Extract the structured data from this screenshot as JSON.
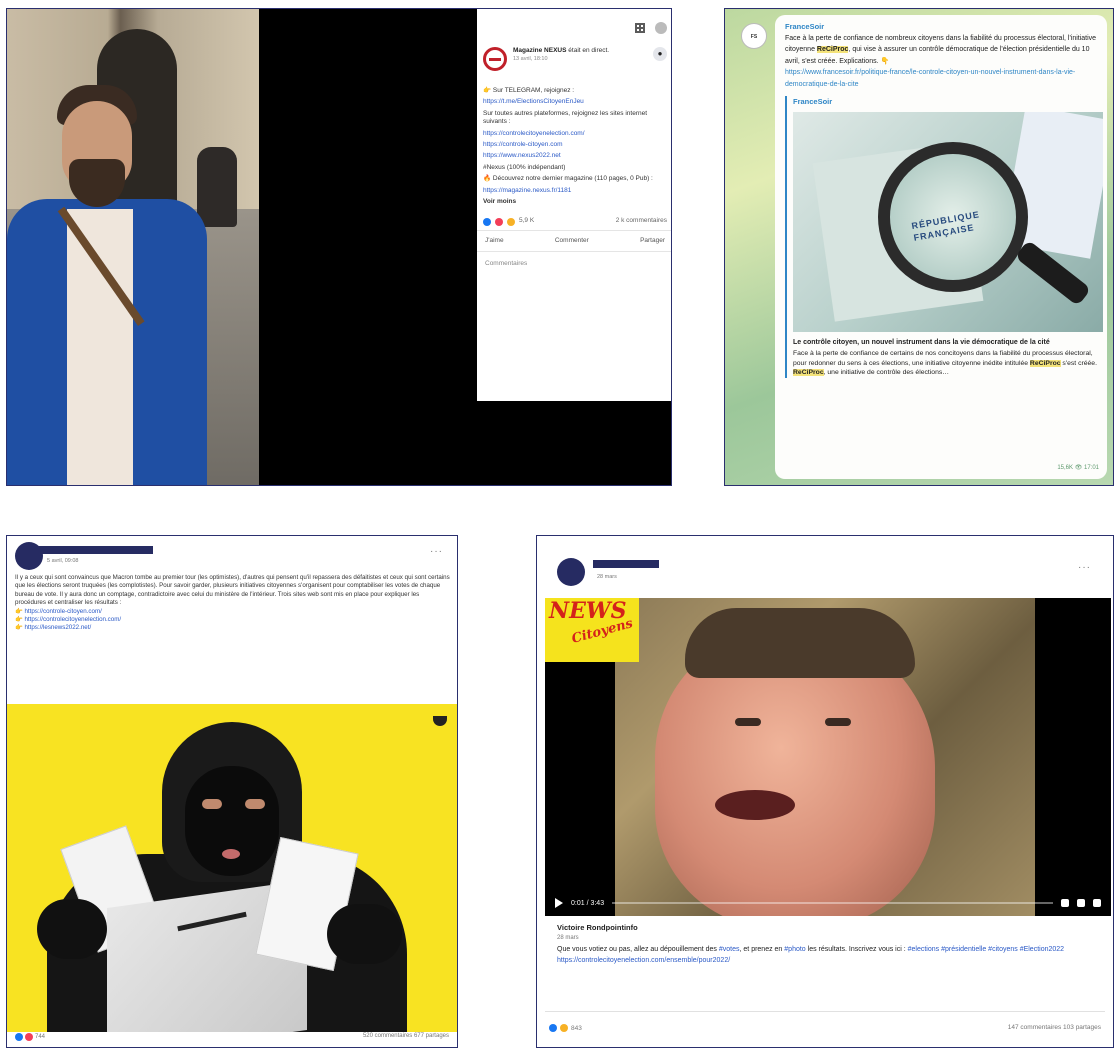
{
  "panel1": {
    "post": {
      "author": "Magazine NEXUS",
      "status": "était en direct.",
      "date": "13 avril, 18:10",
      "line1": "👉 Sur TELEGRAM, rejoignez :",
      "link1": "https://t.me/ElectionsCitoyenEnJeu",
      "line2": "Sur toutes autres plateformes, rejoignez les sites internet suivants :",
      "link2": "https://controlecitoyenelection.com/",
      "link3": "https://controle-citoyen.com",
      "link4": "https://www.nexus2022.net",
      "line3": "#Nexus (100% indépendant)",
      "line4": "🔥 Découvrez notre dernier magazine (110 pages, 0 Pub) :",
      "link5": "https://magazine.nexus.fr/1181",
      "see_more": "Voir moins",
      "reaction_count": "5,9 K",
      "comment_count": "2 k commentaires",
      "action_like": "J'aime",
      "action_comment": "Commenter",
      "action_share": "Partager",
      "comment_placeholder": "Commentaires"
    }
  },
  "panel2": {
    "avatar_label": "FS",
    "channel": "FranceSoir",
    "text_part1": "Face à la perte de confiance de nombreux citoyens dans la fiabilité du processus électoral, l'initiative citoyenne ",
    "highlight": "ReCiProc",
    "text_part2": ", qui vise à assurer un contrôle démocratique de l'élection présidentielle du 10 avril, s'est créée. Explications. 👇",
    "link": "https://www.francesoir.fr/politique-france/le-controle-citoyen-un-nouvel-instrument-dans-la-vie-democratique-de-la-cite",
    "preview_source": "FranceSoir",
    "preview_image_text": "RÉPUBLIQUE FRANÇAISE",
    "preview_title": "Le contrôle citoyen, un nouvel instrument dans la vie démocratique de la cité",
    "preview_desc_part1": "Face à la perte de confiance de certains de nos concitoyens dans la fiabilité du processus électoral, pour redonner du sens à ces élections, une initiative citoyenne inédite intitulée ",
    "preview_desc_part2": " s'est créée. ",
    "preview_desc_part3": ", une initiative de contrôle des élections…",
    "views": "15,6K",
    "time": "17:01"
  },
  "panel3": {
    "date": "5 avril, 09:08",
    "text": "Il y a ceux qui sont convaincus que Macron tombe au premier tour (les optimistes), d'autres qui pensent qu'il repassera des défaitistes et ceux qui sont certains que les élections seront truquées (les complotistes). Pour savoir garder, plusieurs initiatives citoyennes s'organisent pour comptabiliser les votes de chaque bureau de vote. Il y aura donc un comptage, contradictoire avec celui du ministère de l'intérieur. Trois sites web sont mis en place pour expliquer les procédures et centraliser les résultats :",
    "link1": "https://controle-citoyen.com/",
    "link2": "https://controlecitoyenelection.com/",
    "link3": "https://lesnews2022.net/",
    "reaction_count": "744",
    "stats": "520 commentaires 677 partages"
  },
  "panel4": {
    "date": "28 mars",
    "news_word": "NEWS",
    "citoyens_word": "Citoyens",
    "video_time": "0:01 / 3:43",
    "author": "Victoire Rondpointinfo",
    "author_date": "28 mars",
    "text_part1": "Que vous votiez ou pas, allez au dépouillement des ",
    "tag1": "#votes",
    "text_part2": ", et prenez en ",
    "tag2": "#photo",
    "text_part3": " les résultats. Inscrivez vous ici : ",
    "tag3": "#elections #présidentielle #citoyens #Election2022",
    "link": "https://controlecitoyenelection.com/ensemble/pour2022/",
    "reaction_count": "843",
    "stats": "147 commentaires 103 partages"
  },
  "colors": {
    "redaction": "#262b62",
    "link": "#2a59c6",
    "telegram_link": "#2f86c6",
    "highlight": "#f4e37a",
    "news_yellow": "#f5e31d",
    "news_red": "#d4221b"
  }
}
